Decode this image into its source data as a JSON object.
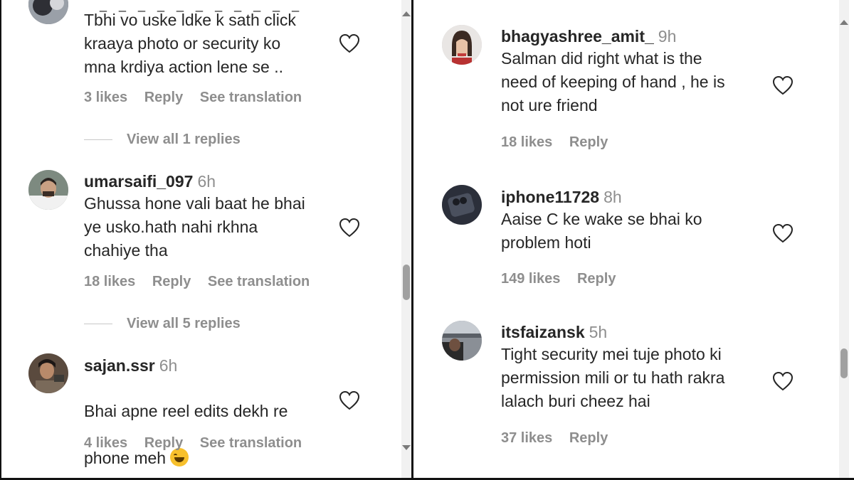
{
  "left": {
    "comments": [
      {
        "username": "",
        "time": "",
        "text": "Tbhi vo uske ldke k sath click\nkraaya photo or security ko\nmna krdiya action lene se ..",
        "likes": "3 likes",
        "reply": "Reply",
        "translate": "See translation",
        "view_replies": "View all 1 replies"
      },
      {
        "username": "umarsaifi_097",
        "time": "6h",
        "text": "Ghussa hone vali baat he bhai\nye usko.hath nahi rkhna\nchahiye tha",
        "likes": "18 likes",
        "reply": "Reply",
        "translate": "See translation",
        "view_replies": "View all 5 replies"
      },
      {
        "username": "sajan.ssr",
        "time": "6h",
        "text_line1": "Bhai apne reel edits dekh re",
        "text_line2": "phone meh",
        "emoji": "face-with-tears-of-joy",
        "likes": "4 likes",
        "reply": "Reply",
        "translate": "See translation"
      }
    ]
  },
  "right": {
    "comments": [
      {
        "username": "bhagyashree_amit_",
        "time": "9h",
        "text": "Salman did right what is the\nneed of keeping of hand , he is\nnot ure friend",
        "likes": "18 likes",
        "reply": "Reply"
      },
      {
        "username": "iphone11728",
        "time": "8h",
        "text": "Aaise C ke wake se bhai ko\nproblem hoti",
        "likes": "149 likes",
        "reply": "Reply"
      },
      {
        "username": "itsfaizansk",
        "time": "5h",
        "text": "Tight security mei tuje photo ki\npermission mili or tu hath rakra\nlalach buri cheez hai",
        "likes": "37 likes",
        "reply": "Reply"
      }
    ]
  },
  "colors": {
    "text": "#262626",
    "muted": "#8e8e8e",
    "divider": "#111111"
  },
  "icons": [
    "heart-icon",
    "scroll-up-icon",
    "scroll-down-icon"
  ]
}
